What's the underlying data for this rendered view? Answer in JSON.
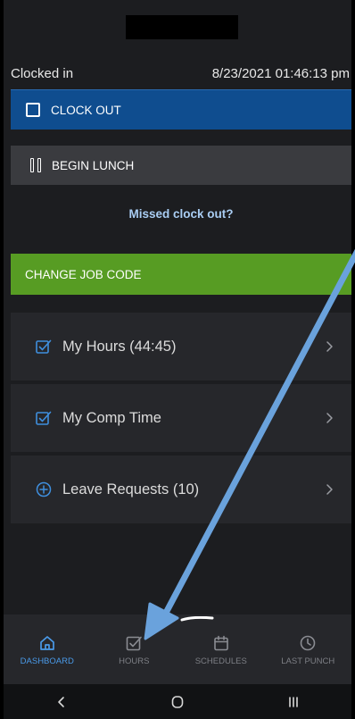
{
  "status": {
    "label": "Clocked in",
    "datetime": "8/23/2021 01:46:13 pm"
  },
  "actions": {
    "clock_out": "CLOCK OUT",
    "begin_lunch": "BEGIN LUNCH",
    "missed_clock_out": "Missed clock out?",
    "change_job_code": "CHANGE JOB CODE"
  },
  "list": [
    {
      "label": "My Hours (44:45)",
      "icon": "checkbox-icon"
    },
    {
      "label": "My Comp Time",
      "icon": "checkbox-icon"
    },
    {
      "label": "Leave Requests (10)",
      "icon": "plus-circle-icon"
    }
  ],
  "nav": [
    {
      "label": "DASHBOARD",
      "icon": "home-icon",
      "active": true
    },
    {
      "label": "HOURS",
      "icon": "checkbox-icon",
      "active": false
    },
    {
      "label": "SCHEDULES",
      "icon": "calendar-icon",
      "active": false
    },
    {
      "label": "LAST PUNCH",
      "icon": "clock-icon",
      "active": false
    }
  ],
  "colors": {
    "primary_blue": "#0f4d8f",
    "accent_green": "#579c23",
    "link_blue": "#a9cdf3",
    "active_nav": "#4a9ae8",
    "annotation_arrow": "#6aa2dc"
  }
}
